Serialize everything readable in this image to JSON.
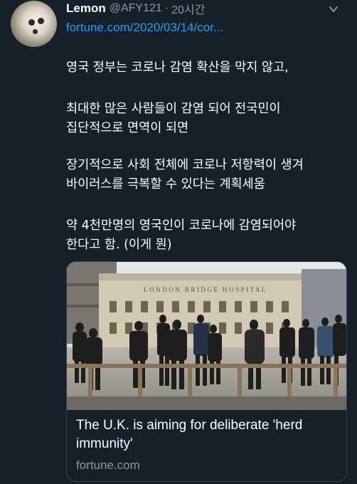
{
  "tweet": {
    "display_name": "Lemon",
    "handle": "@AFY121",
    "separator": "·",
    "time": "20시간",
    "link_text": "fortune.com/2020/03/14/cor...",
    "body_lines": [
      "영국 정부는 코로나 감염 확산을 막지 않고,",
      "최대한 많은 사람들이 감염 되어 전국민이",
      "집단적으로 면역이 되면",
      "장기적으로 사회 전체에 코로나 저항력이 생겨",
      "바이러스를 극복할 수 있다는 계획세움",
      "약 4천만명의 영국인이 코로나에 감염되어야",
      "한다고 함. (이게 뭔)"
    ]
  },
  "card": {
    "image_sign": "LONDON BRIDGE HOSPITAL",
    "title": "The U.K. is aiming for deliberate 'herd immunity'",
    "domain": "fortune.com"
  },
  "icons": {
    "menu": "chevron-down-icon",
    "avatar": "avatar-photo"
  },
  "colors": {
    "background": "#15202b",
    "link": "#1da1f2",
    "secondary_text": "#8899a6",
    "card_border": "#38444d"
  }
}
